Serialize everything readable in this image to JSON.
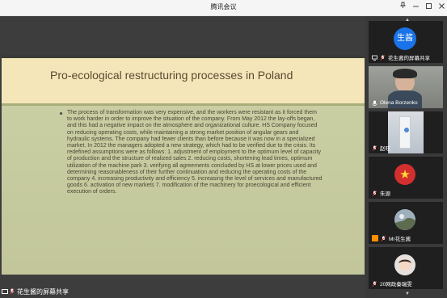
{
  "window": {
    "title": "腾讯会议",
    "pin_icon": "pin-icon",
    "min_icon": "minimize-icon",
    "max_icon": "maximize-icon",
    "close_icon": "close-icon"
  },
  "share": {
    "label": "花生酱的屏幕共享"
  },
  "slide": {
    "title": "Pro-ecological restructuring processes in Poland",
    "body": "The process of transformation was very expensive, and the workers were resistant as it forced them to work harder in order to improve the situation of the company. From May 2012 the lay-offs began, and this had a negative impact on the atmosphere and organizational culture. HS Company focused on reducing operating costs, while maintaining a strong market position of angular gears and hydraulic systems. The company had fewer clients than before because it was now in a specialized market. In 2012 the managers adopted a new strategy, which had to be verified due to the crisis. Its redefined assumptions were as follows: 1. adjustment of employment to the optimum level of capacity of production and the structure of realized sales 2. reducing costs, shortening lead times, optimum utilization of the machine park 3. verifying all agreements concluded by HS at lower prices used and determining reasonableness of their further continuation and reducing the operating costs of the company 4. increasing productivity and efficiency 5. increasing the level of services and manufactured goods 6. activation of new markets 7. modification of the machinery for proecological and efficient execution of orders."
  },
  "participants": [
    {
      "name": "花生酱的屏幕共享",
      "avatar_text": "生酱",
      "icon": "screen-share-icon"
    },
    {
      "name": "Olena Borzenko",
      "icon": "mic-icon"
    },
    {
      "name": "赵旺",
      "icon": "mic-muted-icon"
    },
    {
      "name": "朱源",
      "icon": "mic-muted-icon"
    },
    {
      "name": "Mr花生酱",
      "icon": "host-badge-icon"
    },
    {
      "name": "20网政秦瑞雯",
      "icon": "mic-muted-icon"
    }
  ],
  "colors": {
    "active_border": "#3bcf6a",
    "avatar_blue": "#1a73e8"
  }
}
